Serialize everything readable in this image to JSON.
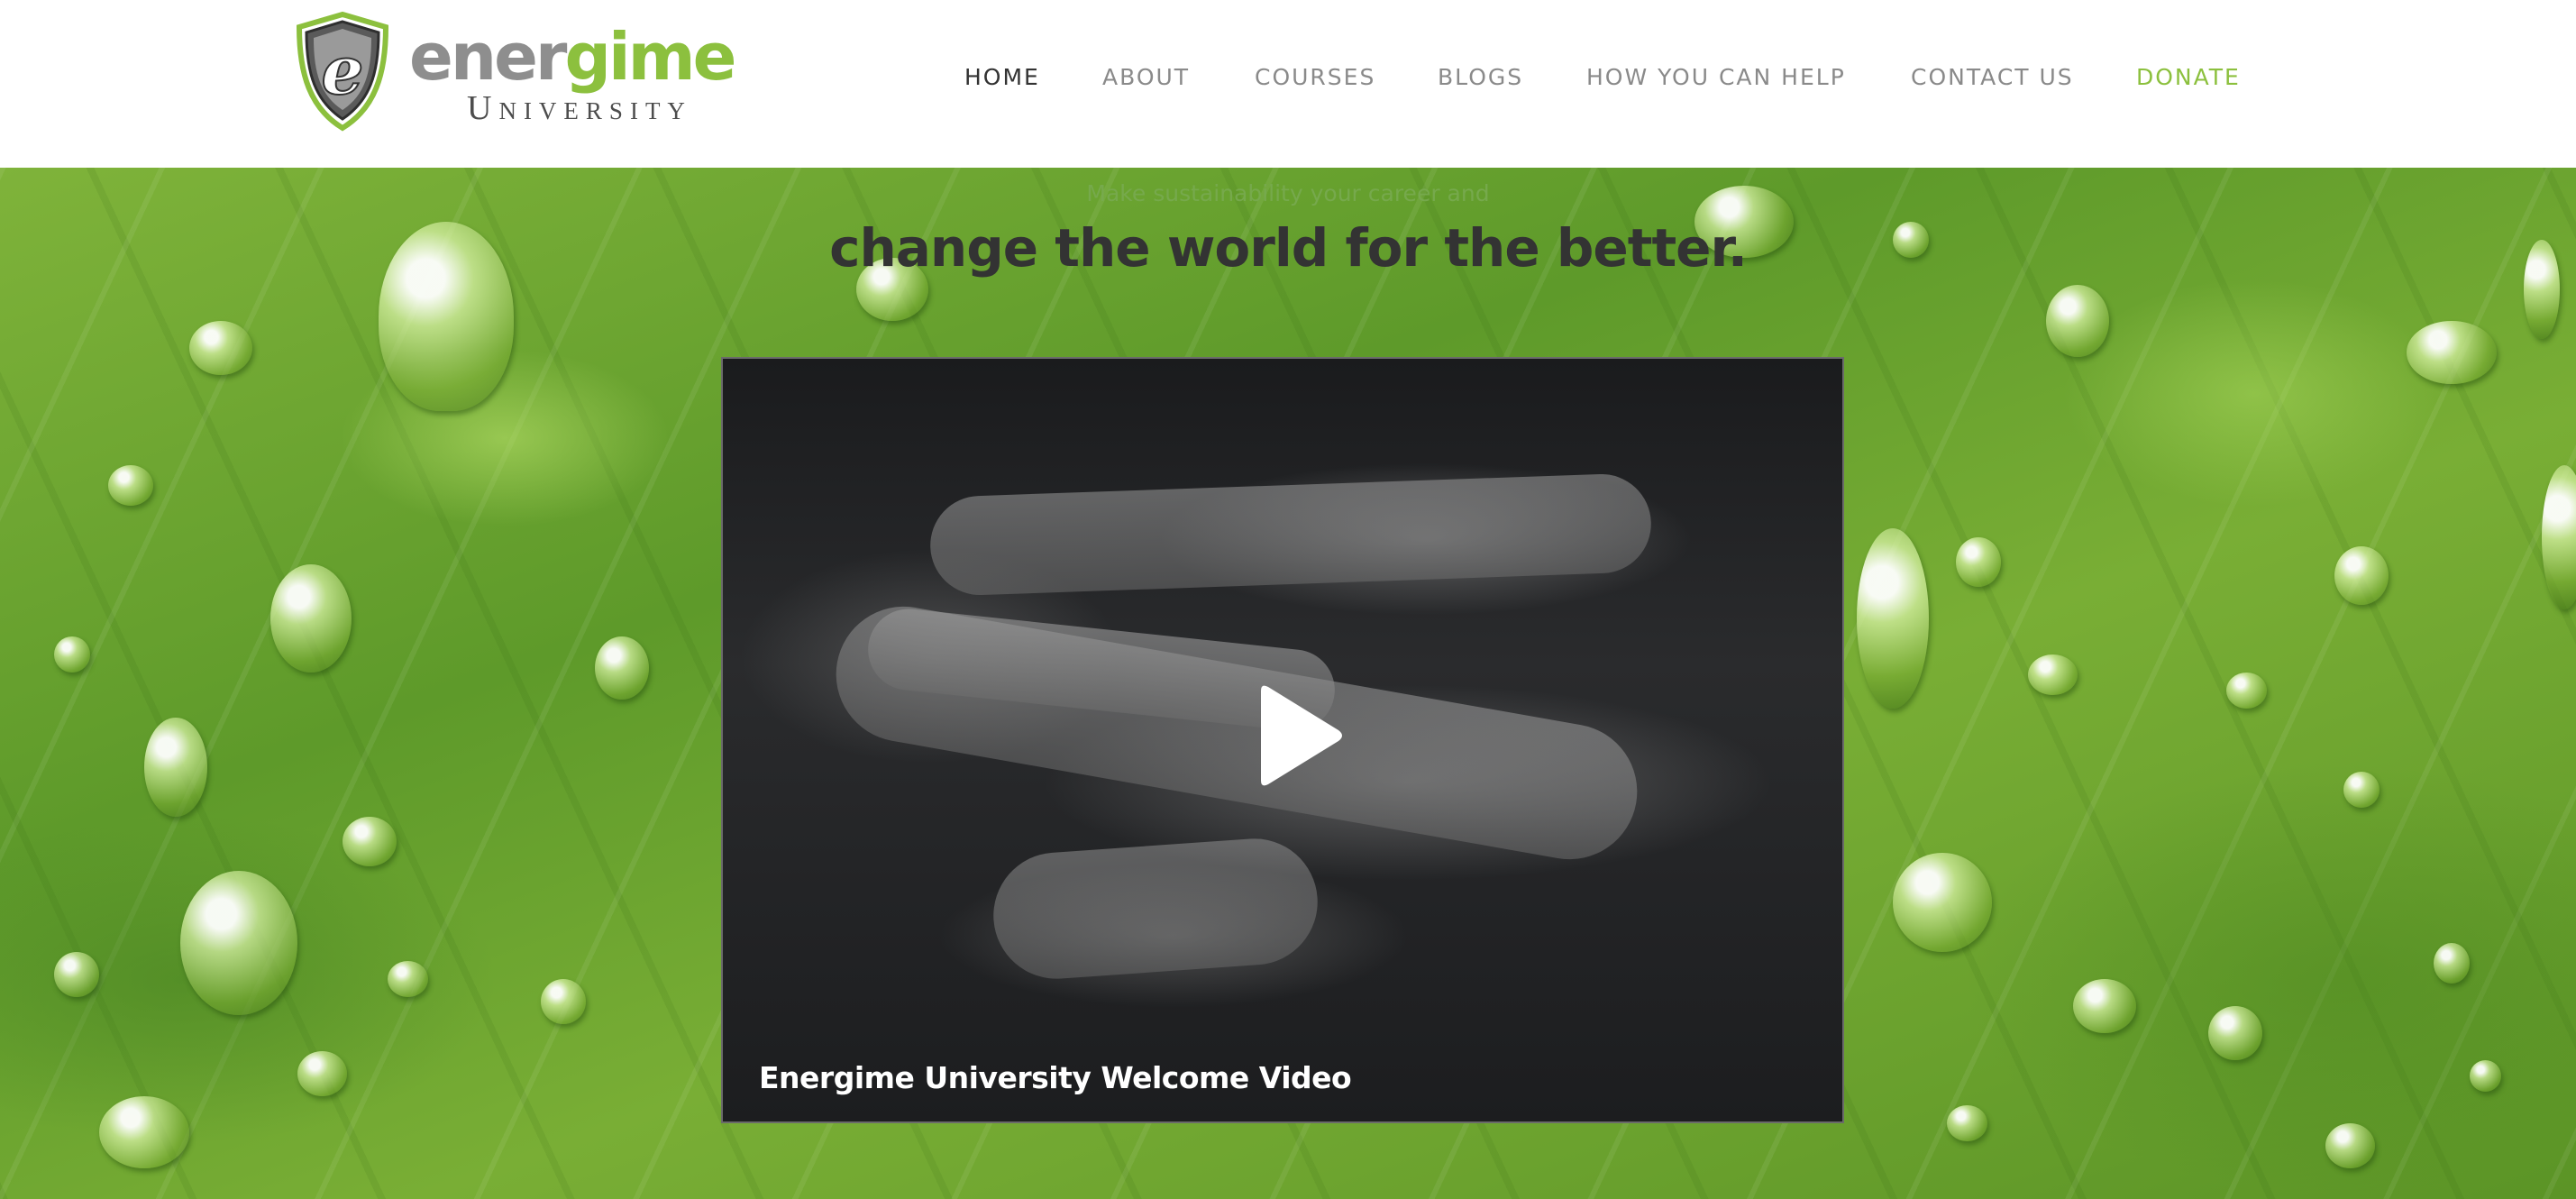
{
  "logo": {
    "word_grey": "ener",
    "word_green": "gime",
    "subtitle": "University"
  },
  "nav": {
    "items": [
      {
        "label": "HOME",
        "state": "active"
      },
      {
        "label": "ABOUT"
      },
      {
        "label": "COURSES"
      },
      {
        "label": "BLOGS"
      },
      {
        "label": "HOW YOU CAN HELP"
      },
      {
        "label": "CONTACT US"
      },
      {
        "label": "DONATE",
        "style": "accent"
      }
    ]
  },
  "hero": {
    "kicker": "Make sustainability your career and",
    "title": "change the world for the better."
  },
  "video": {
    "caption": "Energime University Welcome Video",
    "play_icon": "play-icon"
  },
  "colors": {
    "brand_green": "#8cc03e",
    "nav_text": "#8a8a8a",
    "nav_active": "#333333",
    "title_text": "#333333"
  }
}
